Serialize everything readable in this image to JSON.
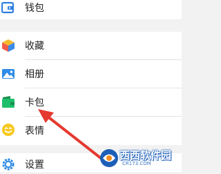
{
  "menu": {
    "wallet_label": "钱包",
    "favorites_label": "收藏",
    "album_label": "相册",
    "cards_label": "卡包",
    "stickers_label": "表情",
    "settings_label": "设置"
  },
  "icons": {
    "wallet": "wallet-icon",
    "favorites": "cube-icon",
    "album": "photo-icon",
    "cards": "card-icon",
    "stickers": "smiley-icon",
    "settings": "gear-icon"
  },
  "colors": {
    "wallet_icon": "#2d7de1",
    "cube_red": "#f05a4b",
    "cube_yellow": "#f6b92b",
    "cube_blue": "#3b8be8",
    "photo_icon": "#2f8be6",
    "card_green": "#1dbf6a",
    "card_dark": "#1a8f4f",
    "smiley": "#f7c81e",
    "gear": "#2d8ae5",
    "arrow": "#e5392f",
    "page_bg": "#f2f2f2"
  },
  "watermark": {
    "brand": "西西软件园",
    "url": "CR173.COM"
  }
}
